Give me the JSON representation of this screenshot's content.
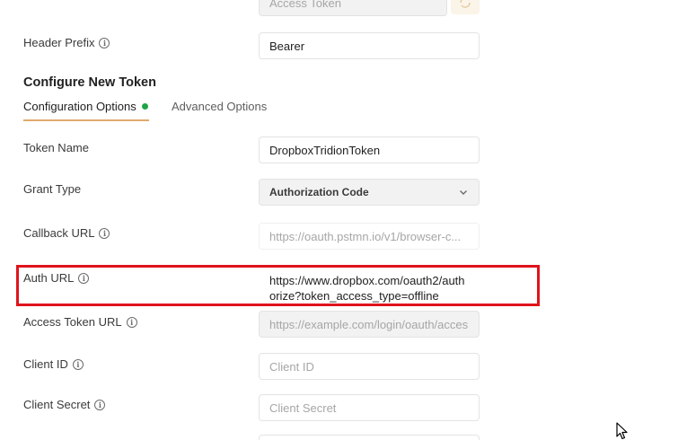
{
  "top_field": {
    "placeholder": "Access Token"
  },
  "header_prefix": {
    "label": "Header Prefix",
    "value": "Bearer"
  },
  "section_title": "Configure New Token",
  "tabs": [
    {
      "label": "Configuration Options",
      "active": true
    },
    {
      "label": "Advanced Options",
      "active": false
    }
  ],
  "fields": {
    "token_name": {
      "label": "Token Name",
      "value": "DropboxTridionToken"
    },
    "grant_type": {
      "label": "Grant Type",
      "value": "Authorization Code"
    },
    "callback_url": {
      "label": "Callback URL",
      "value": "https://oauth.pstmn.io/v1/browser-c..."
    },
    "auth_url": {
      "label": "Auth URL",
      "value": "https://www.dropbox.com/oauth2/authorize?token_access_type=offline"
    },
    "access_token_url": {
      "label": "Access Token URL",
      "placeholder": "https://example.com/login/oauth/acces"
    },
    "client_id": {
      "label": "Client ID",
      "placeholder": "Client ID"
    },
    "client_secret": {
      "label": "Client Secret",
      "placeholder": "Client Secret"
    }
  },
  "colors": {
    "accent_underline": "#e0a96d",
    "active_dot": "#1ea446",
    "highlight_box": "#e0141c"
  }
}
